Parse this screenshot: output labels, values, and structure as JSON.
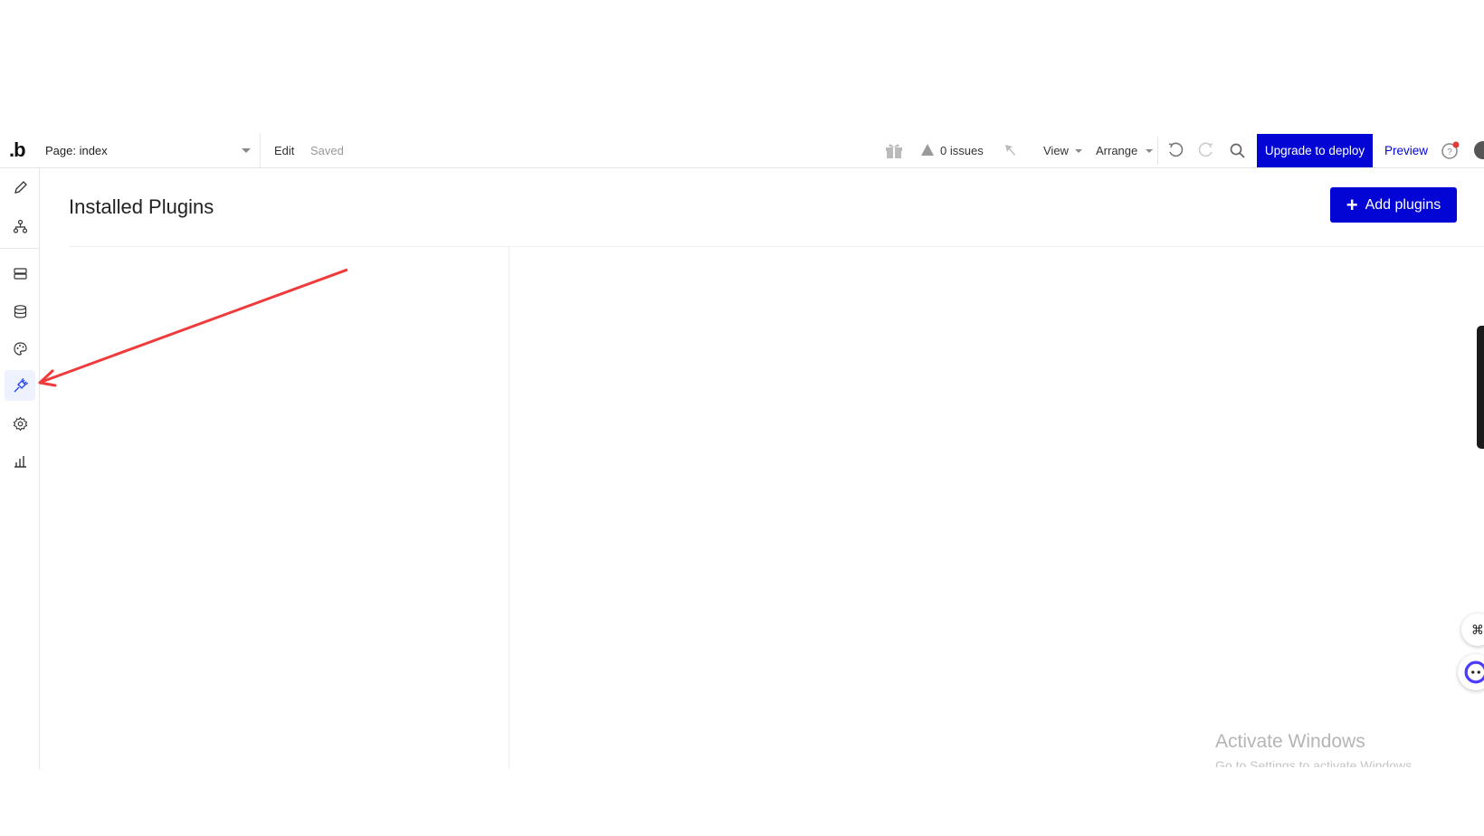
{
  "topbar": {
    "logo": ".b",
    "page_label": "Page: index",
    "edit_label": "Edit",
    "saved_label": "Saved",
    "issues_label": "0 issues",
    "view_label": "View",
    "arrange_label": "Arrange",
    "deploy_label": "Upgrade to deploy",
    "preview_label": "Preview"
  },
  "sidebar": {
    "items": [
      {
        "icon": "pencil-icon"
      },
      {
        "icon": "hierarchy-icon"
      },
      {
        "icon": "server-icon"
      },
      {
        "icon": "database-icon"
      },
      {
        "icon": "palette-icon"
      },
      {
        "icon": "plug-icon",
        "active": true
      },
      {
        "icon": "gear-icon"
      },
      {
        "icon": "bar-chart-icon"
      }
    ]
  },
  "main": {
    "title": "Installed Plugins",
    "add_button_label": "Add plugins"
  },
  "watermark": {
    "title": "Activate Windows",
    "subtitle": "Go to Settings to activate Windows."
  },
  "colors": {
    "accent": "#0205d3",
    "annotation_arrow": "#ef3b3b",
    "active_sidebar_bg": "#eef2ff"
  }
}
